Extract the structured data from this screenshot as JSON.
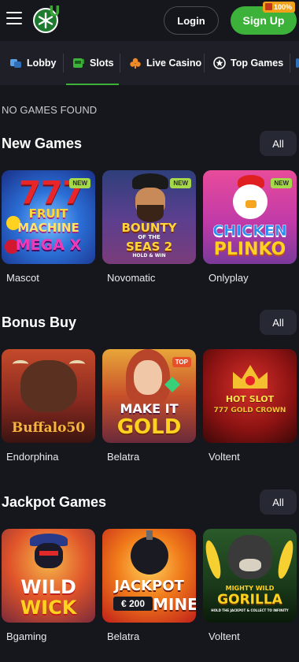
{
  "header": {
    "login_label": "Login",
    "signup_label": "Sign Up",
    "bonus_badge": "100%"
  },
  "nav": {
    "items": [
      {
        "label": "Lobby",
        "icon": "lobby-icon"
      },
      {
        "label": "Slots",
        "icon": "slots-icon",
        "active": true
      },
      {
        "label": "Live Casino",
        "icon": "live-casino-icon"
      },
      {
        "label": "Top Games",
        "icon": "top-games-icon"
      }
    ]
  },
  "status_text": "NO GAMES FOUND",
  "sections": [
    {
      "title": "New Games",
      "all_label": "All",
      "games": [
        {
          "title_lines": [
            "FRUIT",
            "MACHINE",
            "MEGA X"
          ],
          "tag": "NEW",
          "provider": "Mascot"
        },
        {
          "title_lines": [
            "BOUNTY",
            "OF THE",
            "SEAS 2",
            "HOLD & WIN"
          ],
          "tag": "NEW",
          "provider": "Novomatic"
        },
        {
          "title_lines": [
            "CHICKEN",
            "PLINKO"
          ],
          "tag": "NEW",
          "provider": "Onlyplay"
        }
      ]
    },
    {
      "title": "Bonus Buy",
      "all_label": "All",
      "games": [
        {
          "title_lines": [
            "Buffalo50"
          ],
          "tag": "",
          "provider": "Endorphina"
        },
        {
          "title_lines": [
            "MAKE IT",
            "GOLD"
          ],
          "tag": "TOP",
          "provider": "Belatra"
        },
        {
          "title_lines": [
            "HOT SLOT",
            "777 GOLD CROWN"
          ],
          "tag": "",
          "provider": "Voltent"
        }
      ]
    },
    {
      "title": "Jackpot Games",
      "all_label": "All",
      "games": [
        {
          "title_lines": [
            "WILD",
            "WICK"
          ],
          "tag": "",
          "provider": "Bgaming"
        },
        {
          "title_lines": [
            "JACKPOT",
            "€ 200",
            "MINES"
          ],
          "tag": "",
          "provider": "Belatra"
        },
        {
          "title_lines": [
            "MIGHTY WILD",
            "GORILLA",
            "HOLD THE JACKPOT & COLLECT TO INFINITY"
          ],
          "tag": "",
          "provider": "Voltent"
        }
      ]
    }
  ],
  "colors": {
    "background": "#16171d",
    "accent_green": "#3db23a",
    "tag_new": "#a6d94a",
    "tag_top": "#e8502a"
  }
}
